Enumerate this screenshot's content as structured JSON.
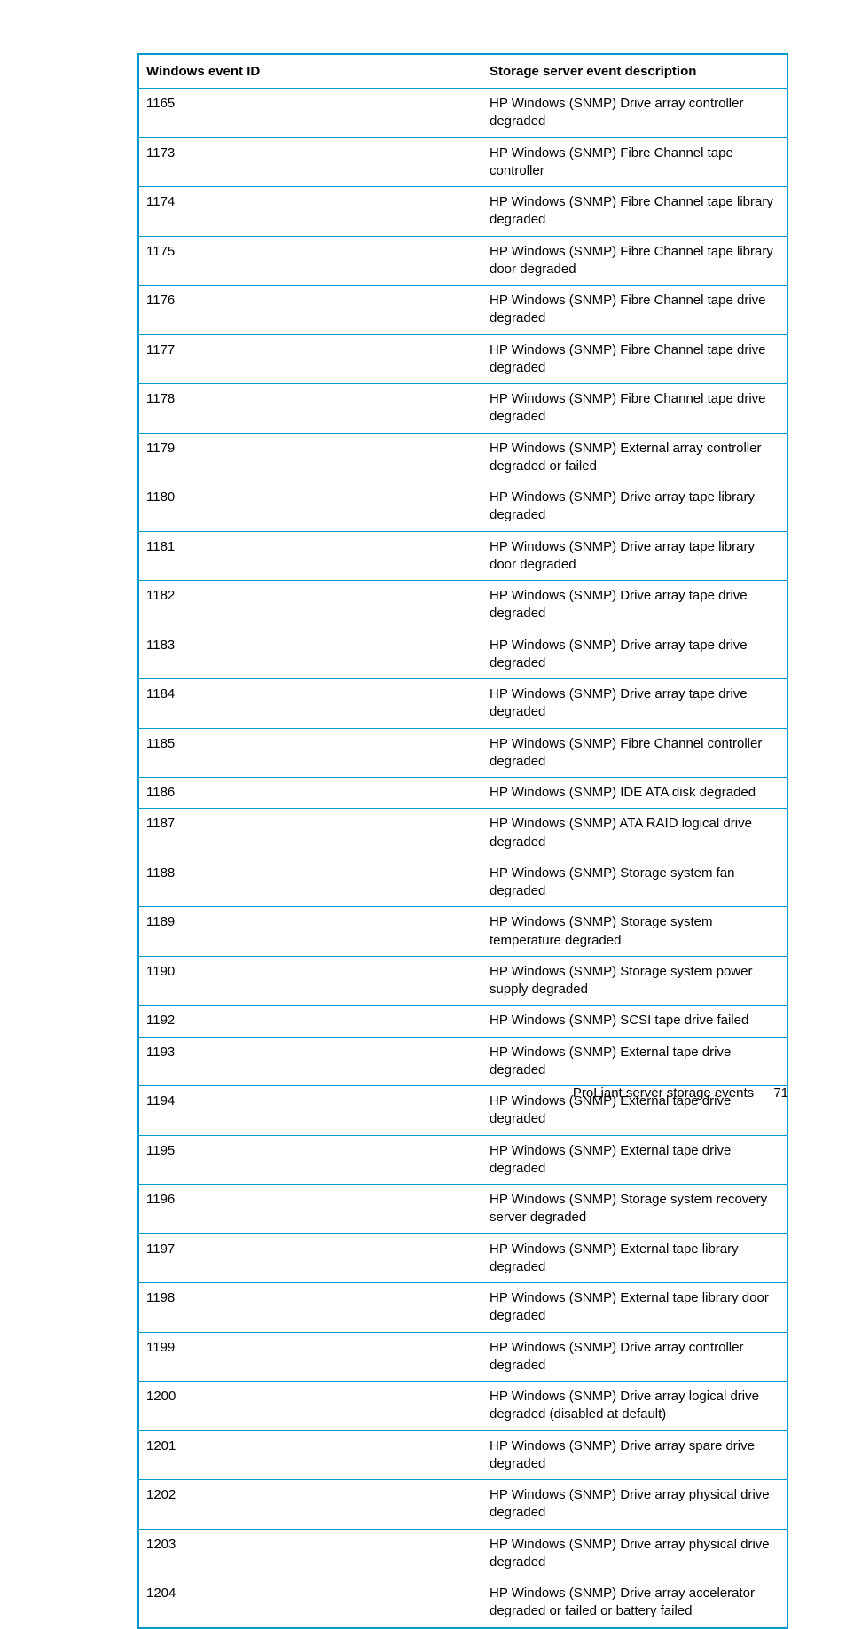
{
  "table": {
    "headers": {
      "id": "Windows event ID",
      "desc": "Storage server event description"
    },
    "rows": [
      {
        "id": "1165",
        "desc": "HP Windows (SNMP) Drive array controller degraded"
      },
      {
        "id": "1173",
        "desc": "HP Windows (SNMP) Fibre Channel tape controller"
      },
      {
        "id": "1174",
        "desc": "HP Windows (SNMP) Fibre Channel tape library degraded"
      },
      {
        "id": "1175",
        "desc": "HP Windows (SNMP) Fibre Channel tape library door degraded"
      },
      {
        "id": "1176",
        "desc": "HP Windows (SNMP) Fibre Channel tape drive degraded"
      },
      {
        "id": "1177",
        "desc": "HP Windows (SNMP) Fibre Channel tape drive degraded"
      },
      {
        "id": "1178",
        "desc": "HP Windows (SNMP) Fibre Channel tape drive degraded"
      },
      {
        "id": "1179",
        "desc": "HP Windows (SNMP) External array controller degraded or failed"
      },
      {
        "id": "1180",
        "desc": "HP Windows (SNMP) Drive array tape library degraded"
      },
      {
        "id": "1181",
        "desc": "HP Windows (SNMP) Drive array tape library door degraded"
      },
      {
        "id": "1182",
        "desc": "HP Windows (SNMP) Drive array tape drive degraded"
      },
      {
        "id": "1183",
        "desc": "HP Windows (SNMP) Drive array tape drive degraded"
      },
      {
        "id": "1184",
        "desc": "HP Windows (SNMP) Drive array tape drive degraded"
      },
      {
        "id": "1185",
        "desc": "HP Windows (SNMP) Fibre Channel controller degraded"
      },
      {
        "id": "1186",
        "desc": "HP Windows (SNMP) IDE ATA disk degraded"
      },
      {
        "id": "1187",
        "desc": "HP Windows (SNMP) ATA RAID logical drive degraded"
      },
      {
        "id": "1188",
        "desc": "HP Windows (SNMP) Storage system fan degraded"
      },
      {
        "id": "1189",
        "desc": "HP Windows (SNMP) Storage system temperature degraded"
      },
      {
        "id": "1190",
        "desc": "HP Windows (SNMP) Storage system power supply degraded"
      },
      {
        "id": "1192",
        "desc": "HP Windows (SNMP) SCSI tape drive failed"
      },
      {
        "id": "1193",
        "desc": "HP Windows (SNMP) External tape drive degraded"
      },
      {
        "id": "1194",
        "desc": "HP Windows (SNMP) External tape drive degraded"
      },
      {
        "id": "1195",
        "desc": "HP Windows (SNMP) External tape drive degraded"
      },
      {
        "id": "1196",
        "desc": "HP Windows (SNMP) Storage system recovery server degraded"
      },
      {
        "id": "1197",
        "desc": "HP Windows (SNMP) External tape library degraded"
      },
      {
        "id": "1198",
        "desc": "HP Windows (SNMP) External tape library door degraded"
      },
      {
        "id": "1199",
        "desc": "HP Windows (SNMP) Drive array controller degraded"
      },
      {
        "id": "1200",
        "desc": "HP Windows (SNMP) Drive array logical drive degraded (disabled at default)"
      },
      {
        "id": "1201",
        "desc": "HP Windows (SNMP) Drive array spare drive degraded"
      },
      {
        "id": "1202",
        "desc": "HP Windows (SNMP) Drive array physical drive degraded"
      },
      {
        "id": "1203",
        "desc": "HP Windows (SNMP) Drive array physical drive degraded"
      },
      {
        "id": "1204",
        "desc": "HP Windows (SNMP) Drive array accelerator degraded or failed or battery failed"
      }
    ]
  },
  "footer": {
    "section": "ProLiant server storage events",
    "page": "71"
  }
}
